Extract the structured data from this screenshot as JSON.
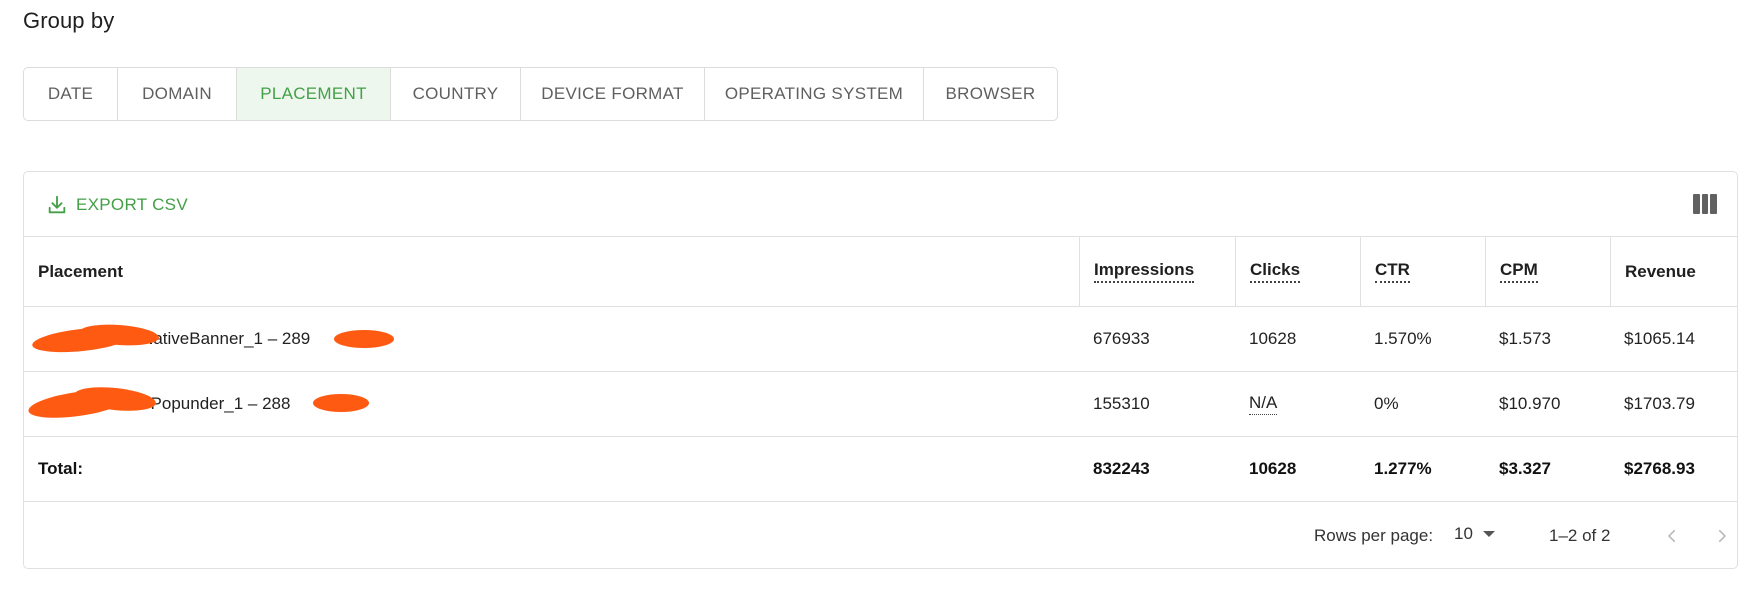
{
  "group_by": {
    "title": "Group by",
    "tabs": [
      {
        "label": "DATE",
        "active": false
      },
      {
        "label": "DOMAIN",
        "active": false
      },
      {
        "label": "PLACEMENT",
        "active": true
      },
      {
        "label": "COUNTRY",
        "active": false
      },
      {
        "label": "DEVICE FORMAT",
        "active": false
      },
      {
        "label": "OPERATING SYSTEM",
        "active": false
      },
      {
        "label": "BROWSER",
        "active": false
      }
    ]
  },
  "toolbar": {
    "export_label": "EXPORT CSV",
    "export_icon": "download-icon",
    "columns_icon": "view-column-icon"
  },
  "table": {
    "columns": [
      "Placement",
      "Impressions",
      "Clicks",
      "CTR",
      "CPM",
      "Revenue"
    ],
    "rows": [
      {
        "placement": "et – NativeBanner_1 – 289",
        "impressions": "676933",
        "clicks": "10628",
        "ctr": "1.570%",
        "cpm": "$1.573",
        "revenue": "$1065.14"
      },
      {
        "placement": "net – Popunder_1 – 288",
        "impressions": "155310",
        "clicks": "N/A",
        "ctr": "0%",
        "cpm": "$10.970",
        "revenue": "$1703.79"
      }
    ],
    "total": {
      "label": "Total:",
      "impressions": "832243",
      "clicks": "10628",
      "ctr": "1.277%",
      "cpm": "$3.327",
      "revenue": "$2768.93"
    }
  },
  "pagination": {
    "rows_per_page_label": "Rows per page:",
    "rows_per_page_value": "10",
    "range_label": "1–2 of 2",
    "prev_icon": "chevron-left-icon",
    "next_icon": "chevron-right-icon"
  },
  "colors": {
    "accent": "#43a047",
    "active_tab_bg": "#eef7ee",
    "redaction": "#ff5a12"
  }
}
